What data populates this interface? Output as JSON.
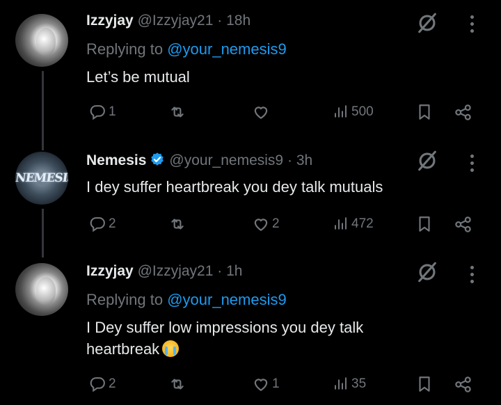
{
  "tweets": [
    {
      "display_name": "Izzyjay",
      "handle": "@Izzyjay21",
      "sep": "·",
      "time": "18h",
      "replying_prefix": "Replying to",
      "replying_handle": "@your_nemesis9",
      "text": "Let’s be mutual",
      "replies": "1",
      "retweets": "",
      "likes": "",
      "views": "500"
    },
    {
      "display_name": "Nemesis",
      "avatar_text": "NEMESIS",
      "handle": "@your_nemesis9",
      "sep": "·",
      "time": "3h",
      "text": "I dey suffer heartbreak you dey talk mutuals",
      "replies": "2",
      "retweets": "",
      "likes": "2",
      "views": "472"
    },
    {
      "display_name": "Izzyjay",
      "handle": "@Izzyjay21",
      "sep": "·",
      "time": "1h",
      "replying_prefix": "Replying to",
      "replying_handle": "@your_nemesis9",
      "text_line1": "I Dey suffer low impressions you dey talk",
      "text_line2": "heartbreak",
      "emoji_name": "loudly-crying-face-emoji",
      "replies": "2",
      "retweets": "",
      "likes": "1",
      "views": "35"
    }
  ],
  "icons": {
    "reply": "reply-icon",
    "retweet": "retweet-icon",
    "like": "like-icon",
    "views": "views-icon",
    "bookmark": "bookmark-icon",
    "share": "share-icon",
    "grok": "grok-icon",
    "more": "more-icon",
    "verified": "verified-badge-icon"
  },
  "colors": {
    "background": "#000000",
    "text": "#e7e9ea",
    "muted": "#71767b",
    "link": "#1d9bf0",
    "verified": "#1d9bf0"
  }
}
